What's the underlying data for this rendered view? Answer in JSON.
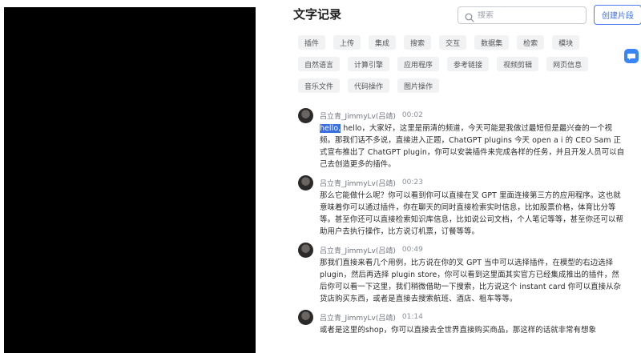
{
  "panel": {
    "title": "文字记录",
    "search_placeholder": "搜索",
    "create_label": "创建片段"
  },
  "tags": [
    [
      "插件",
      "上传",
      "集成",
      "搜索",
      "交互",
      "数据集",
      "检索",
      "模块"
    ],
    [
      "自然语言",
      "计算引擎",
      "应用程序",
      "参考链接",
      "视频剪辑",
      "网页信息"
    ],
    [
      "音乐文件",
      "代码操作",
      "图片操作"
    ]
  ],
  "entries": [
    {
      "speaker": "吕立青_JimmyLv(吕靖)",
      "time": "00:02",
      "highlight": "hello,",
      "text": " hello，大家好，这里是丽清的频道，今天可能是我做过最短但是最兴奋的一个视频。那我们话不多说，直接进入正题，ChatGPT plugins 今天 open a i 的 CEO Sam 正式宣布推出了 ChatGPT plugin，你可以安装插件来完成各样的任务，并且开发人员可以自己去创造更多的插件。"
    },
    {
      "speaker": "吕立青_JimmyLv(吕靖)",
      "time": "00:23",
      "highlight": "",
      "text": "那么它能做什么呢？你可以看到你可以直接在叉 GPT 里面连接第三方的应用程序。这也就意味着你可以通过插件，你在聊天的同时直接检索实时信息，比如股票价格，体育比分等等。甚至你还可以直接检索知识库信息，比如说公司文档，个人笔记等等，甚至你还可以帮助用户去执行操作，比方说订机票，订餐等等。"
    },
    {
      "speaker": "吕立青_JimmyLv(吕靖)",
      "time": "00:49",
      "highlight": "",
      "text": "那我们直接来看几个用例，比方说在你的叉 GPT 当中可以选择插件，在模型的右边选择plugin，然后再选择 plugin store，你可以看到这里面其实官方已经集成推出的插件，然后你可以看一下这里，我们稍微借助一下搜索，比方说这个 instant card 你可以直接从杂货店购买东西，或者是直接去搜索航班、酒店、租车等等。"
    },
    {
      "speaker": "吕立青_JimmyLv(吕靖)",
      "time": "01:14",
      "highlight": "",
      "text": "或者是这里的shop，你可以直接去全世界直接购买商品，那这样的话就非常有想象"
    }
  ]
}
